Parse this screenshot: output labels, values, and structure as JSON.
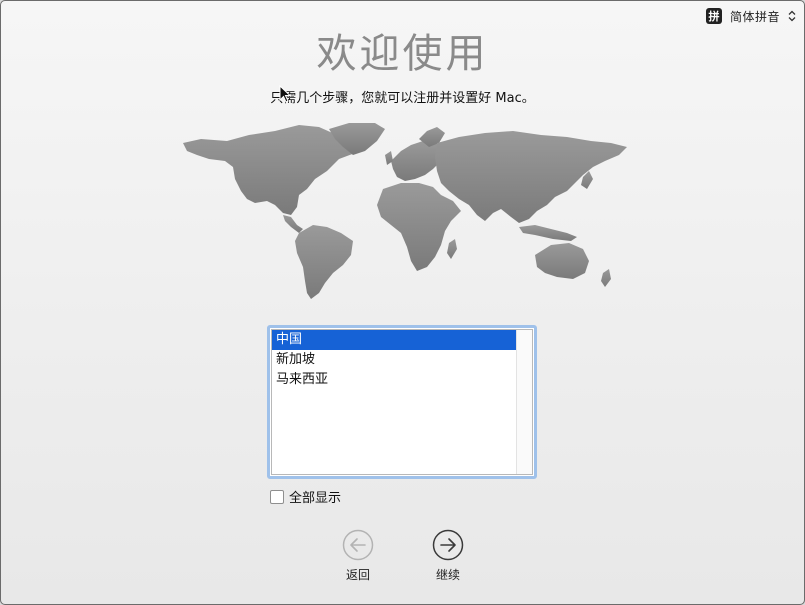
{
  "input_menu": {
    "badge": "拼",
    "label": "简体拼音",
    "icon": "updown-chevron-icon"
  },
  "header": {
    "title": "欢迎使用",
    "subtitle": "只需几个步骤，您就可以注册并设置好 Mac。"
  },
  "country_list": {
    "items": [
      "中国",
      "新加坡",
      "马来西亚"
    ],
    "selected": "中国"
  },
  "show_all": {
    "label": "全部显示",
    "checked": false
  },
  "navigation": {
    "back_label": "返回",
    "continue_label": "继续",
    "back_icon": "arrow-left-circle-icon",
    "continue_icon": "arrow-right-circle-icon"
  },
  "colors": {
    "selection": "#1662d6",
    "focus_ring": "#9fc1ea",
    "map_land": "#8c8c8c"
  }
}
